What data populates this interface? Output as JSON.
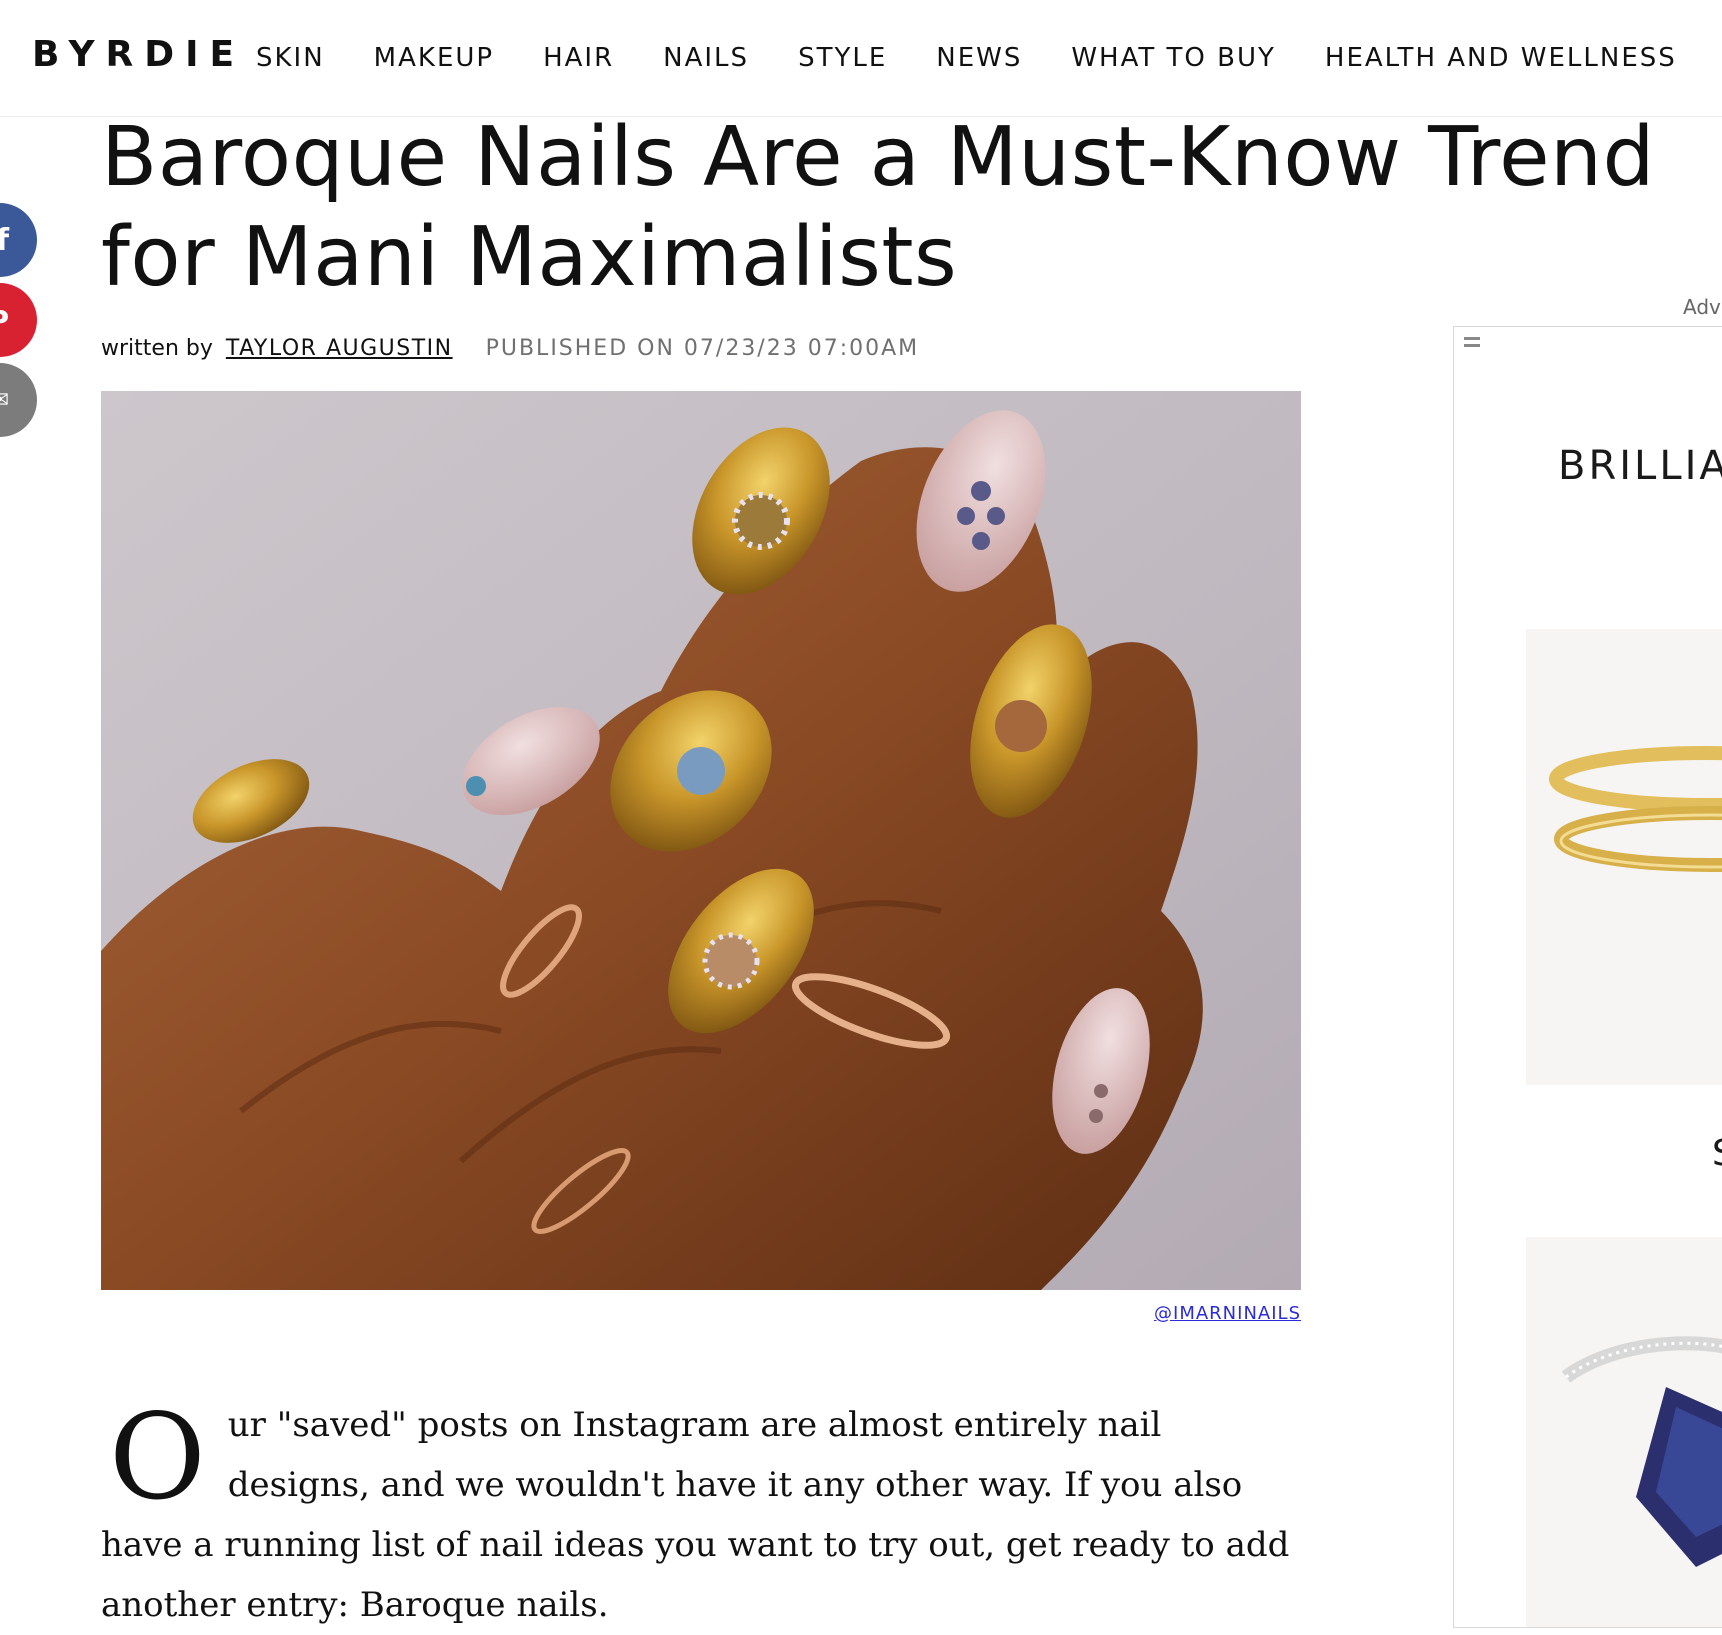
{
  "site": {
    "logo": "BYRDIE",
    "nav": [
      "SKIN",
      "MAKEUP",
      "HAIR",
      "NAILS",
      "STYLE",
      "NEWS",
      "WHAT TO BUY",
      "HEALTH AND WELLNESS"
    ]
  },
  "share": {
    "facebook_glyph": "f",
    "pinterest_glyph": "P",
    "email_glyph": "✉"
  },
  "article": {
    "title": "Baroque Nails Are a Must-Know Trend for Mani Maximalists",
    "byline_prefix": "written by",
    "author": "TAYLOR AUGUSTIN",
    "published": "PUBLISHED ON 07/23/23 07:00AM",
    "image_credit": "@IMARNINAILS",
    "drop_cap": "O",
    "intro": "ur \"saved\" posts on Instagram are almost entirely nail designs, and we wouldn't have it any other way. If you also have a running list of nail ideas you want to try out, get ready to add another entry: Baroque nails."
  },
  "ad": {
    "label": "Adv",
    "headline": "BRILLIA",
    "partial_text": "S"
  },
  "colors": {
    "facebook": "#3b5998",
    "pinterest": "#d92231",
    "email": "#7c7c7c",
    "link": "#2b2bd9"
  }
}
